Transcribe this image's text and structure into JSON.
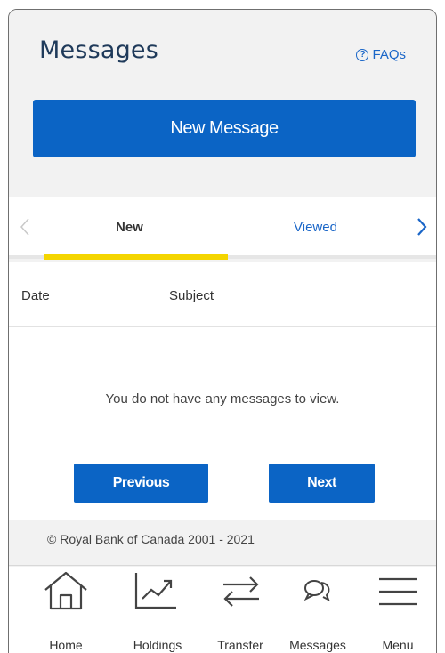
{
  "header": {
    "title": "Messages",
    "faq_label": "FAQs",
    "new_message_label": "New Message"
  },
  "tabs": [
    {
      "label": "New",
      "active": true
    },
    {
      "label": "Viewed",
      "active": false
    }
  ],
  "table": {
    "columns": [
      "Date",
      "Subject"
    ],
    "empty_message": "You do not have any messages to view."
  },
  "pagination": {
    "previous_label": "Previous",
    "next_label": "Next"
  },
  "footer": {
    "copyright": "© Royal Bank of Canada 2001 - 2021"
  },
  "bottom_nav": [
    {
      "label": "Home",
      "icon": "home-icon"
    },
    {
      "label": "Holdings",
      "icon": "chart-trend-icon"
    },
    {
      "label": "Transfer",
      "icon": "transfer-arrows-icon"
    },
    {
      "label": "Messages",
      "icon": "chat-bubbles-icon"
    },
    {
      "label": "Menu",
      "icon": "hamburger-menu-icon"
    }
  ],
  "colors": {
    "primary_button": "#0b64c5",
    "link_blue": "#1a66c8",
    "active_tab_underline": "#f4d500",
    "title_navy": "#1f3a5a"
  }
}
